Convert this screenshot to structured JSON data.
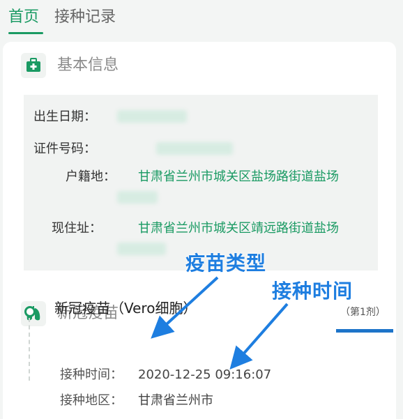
{
  "tabs": [
    {
      "label": "首页",
      "active": true
    },
    {
      "label": "接种记录",
      "active": false
    }
  ],
  "basic_info": {
    "section_title": "基本信息",
    "icon": "medkit-icon",
    "fields": [
      {
        "label": "出生日期：",
        "value": ""
      },
      {
        "label": "证件号码：",
        "value": ""
      },
      {
        "label": "户籍地：",
        "value": "甘肃省兰州市城关区盐场路街道盐场"
      },
      {
        "label": "现住址：",
        "value": "甘肃省兰州市城关区靖远路街道盐场"
      }
    ]
  },
  "vaccine": {
    "section_title": "新冠疫苗",
    "icon": "lungs-icon",
    "record": {
      "name": "新冠疫苗（Vero细胞）",
      "dose": "（第1剂）",
      "time_label": "接种时间：",
      "time_value": "2020-12-25 09:16:07",
      "region_label": "接种地区：",
      "region_value": "甘肃省兰州市"
    }
  },
  "annotations": {
    "vaccine_type": "疫苗类型",
    "vaccination_time": "接种时间"
  },
  "colors": {
    "accent": "#1a9a63",
    "annotation": "#1e7ee0"
  }
}
